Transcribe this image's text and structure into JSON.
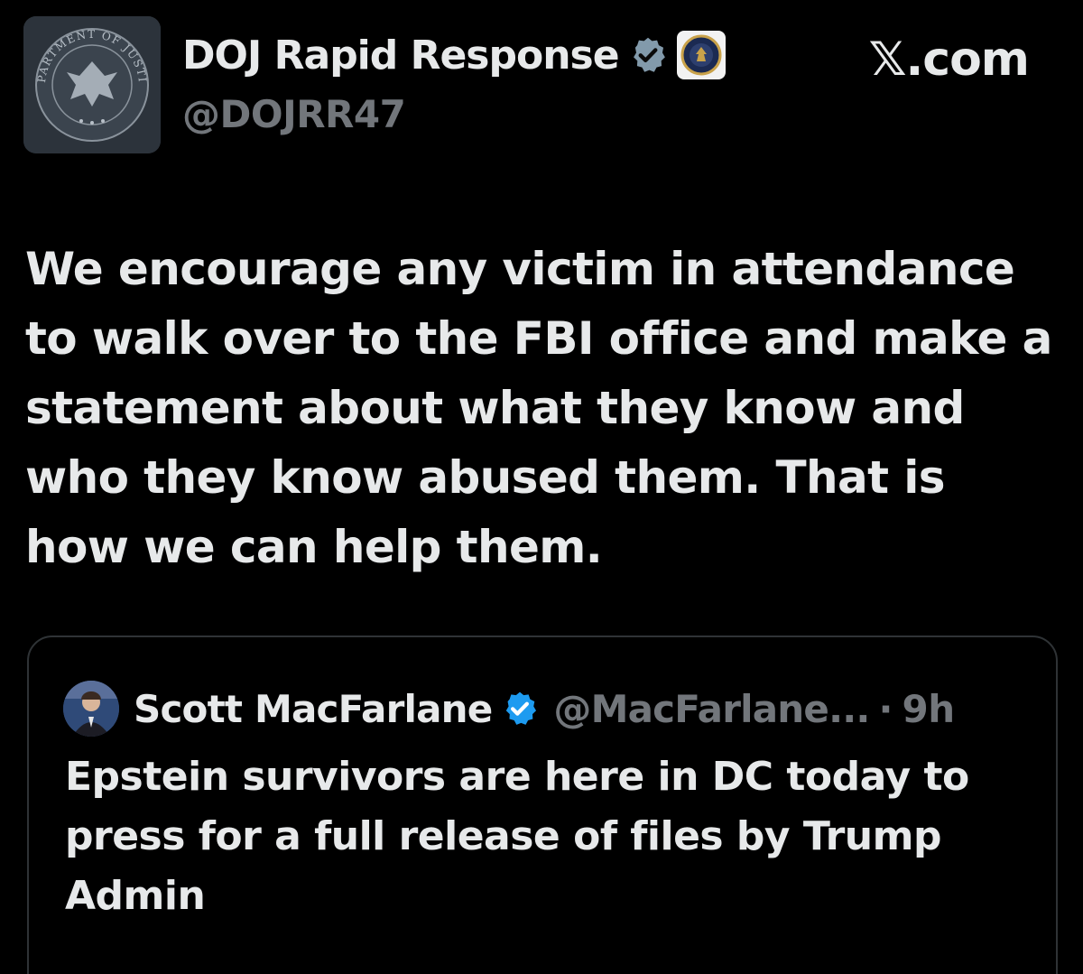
{
  "author": {
    "display_name": "DOJ Rapid Response",
    "handle": "@DOJRR47",
    "avatar_icon": "doj-seal-icon",
    "avatar_text": "DEPARTMENT OF JUSTICE",
    "verified_icon": "verified-badge-icon",
    "affiliate_icon": "doj-affiliate-badge-icon",
    "verified_color": "#829aab"
  },
  "source_label": "𝕏.com",
  "tweet_text": "We encourage any victim in attendance to walk over to the FBI office and make a statement about what they know and who they know abused them. That is how we can help them.",
  "quoted_tweet": {
    "display_name": "Scott MacFarlane",
    "handle": "@MacFarlane...",
    "separator": "·",
    "time": "9h",
    "avatar_icon": "user-avatar-icon",
    "verified_icon": "verified-badge-icon",
    "verified_color": "#1d9bf0",
    "text": "Epstein survivors are here in DC today to press for a full release of files by Trump Admin"
  },
  "colors": {
    "background": "#000000",
    "text_primary": "#e7e9ea",
    "text_secondary": "#72767b",
    "card_border": "#2f3336"
  }
}
